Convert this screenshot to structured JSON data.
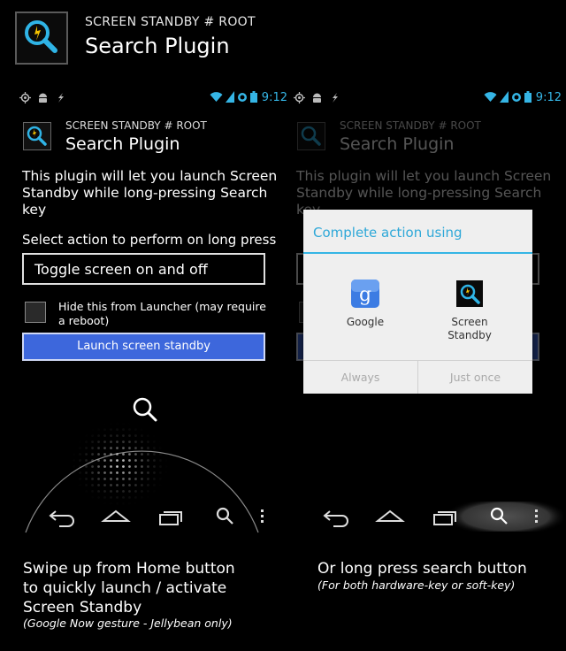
{
  "header": {
    "subtitle": "SCREEN STANDBY # ROOT",
    "title": "Search Plugin"
  },
  "statusbar": {
    "time": "9:12"
  },
  "app": {
    "subtitle": "SCREEN STANDBY # ROOT",
    "title": "Search Plugin",
    "description": "This plugin will let you launch Screen Standby while long-pressing Search key",
    "select_label": "Select action to perform on long press",
    "dropdown_value": "Toggle screen on and off",
    "checkbox_label": "Hide this from Launcher (may require a reboot)",
    "launch_button": "Launch screen standby"
  },
  "dialog": {
    "title": "Complete action using",
    "options": [
      {
        "label": "Google"
      },
      {
        "label": "Screen Standby"
      }
    ],
    "always_button": "Always",
    "just_once_button": "Just once"
  },
  "captions": {
    "left": "Swipe up from Home button to quickly launch / activate Screen Standby",
    "left_note": "(Google Now gesture - Jellybean only)",
    "right": "Or long press search button",
    "right_note": "(For both hardware-key or soft-key)"
  },
  "colors": {
    "accent": "#35b5e5",
    "button": "#3d67dc",
    "dialog_title": "#2ea8d8"
  }
}
